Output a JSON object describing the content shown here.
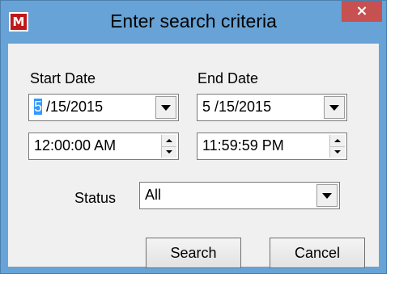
{
  "window": {
    "title": "Enter search criteria",
    "app_icon": "M",
    "close_glyph": "×"
  },
  "start": {
    "label": "Start Date",
    "date_month": "5",
    "date_rest": " /15/2015",
    "time": "12:00:00 AM"
  },
  "end": {
    "label": "End Date",
    "date": "5 /15/2015",
    "time": "11:59:59 PM"
  },
  "status": {
    "label": "Status",
    "selected": "All"
  },
  "buttons": {
    "search": "Search",
    "cancel": "Cancel"
  },
  "colors": {
    "title_bar": "#67a3d6",
    "close_button": "#c75050",
    "dialog_body": "#f0f0f0",
    "selection": "#3399ff"
  },
  "icons": {
    "app": "app-logo-icon",
    "close": "close-icon",
    "dropdown": "chevron-down-icon",
    "spin_up": "spin-up-icon",
    "spin_down": "spin-down-icon"
  }
}
